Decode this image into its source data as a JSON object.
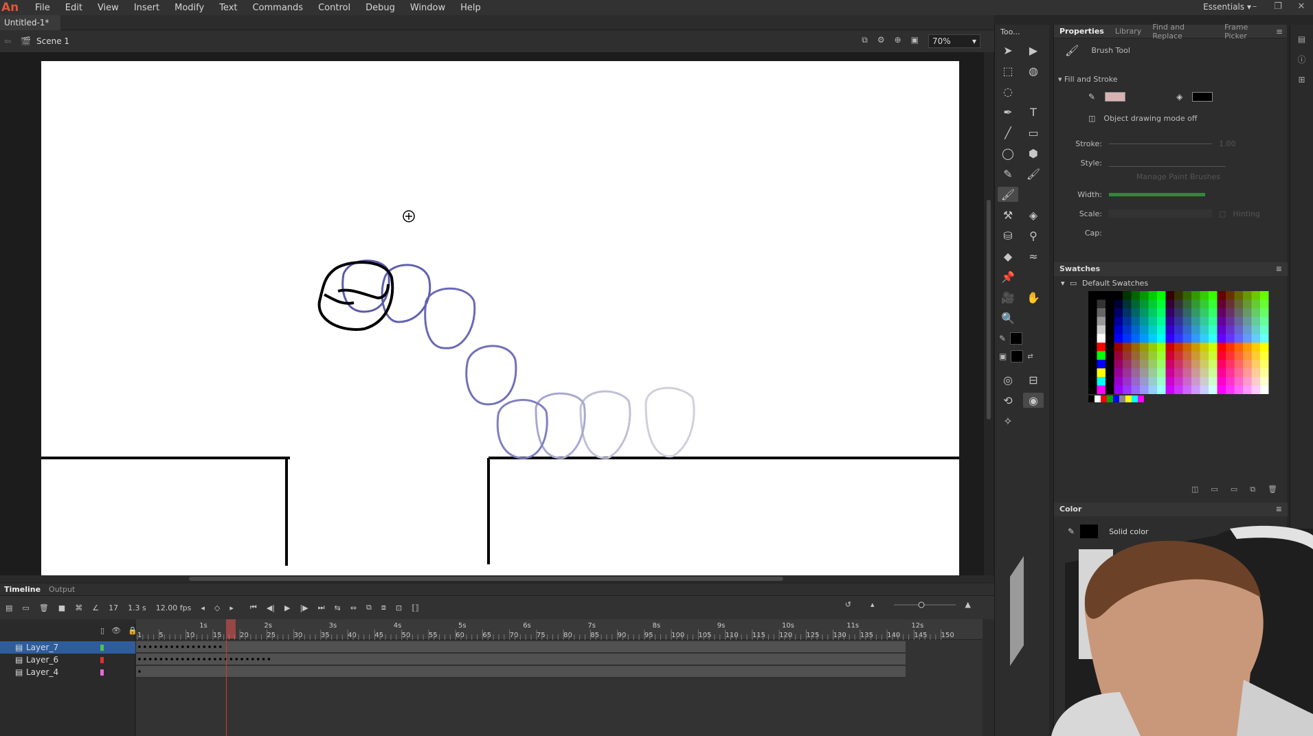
{
  "app": {
    "logo": "An",
    "workspace": "Essentials"
  },
  "menu": [
    "File",
    "Edit",
    "View",
    "Insert",
    "Modify",
    "Text",
    "Commands",
    "Control",
    "Debug",
    "Window",
    "Help"
  ],
  "document": {
    "tab_title": "Untitled-1*",
    "scene": "Scene 1",
    "zoom": "70%"
  },
  "timeline": {
    "tabs": [
      "Timeline",
      "Output"
    ],
    "current_frame": "17",
    "time": "1.3 s",
    "fps": "12.00 fps",
    "second_labels": [
      "1s",
      "2s",
      "3s",
      "4s",
      "5s",
      "6s",
      "7s",
      "8s",
      "9s",
      "10s",
      "11s",
      "12s"
    ],
    "frame_labels": [
      "1",
      "5",
      "10",
      "15",
      "20",
      "25",
      "30",
      "35",
      "40",
      "45",
      "50",
      "55",
      "60",
      "65",
      "70",
      "75",
      "80",
      "85",
      "90",
      "95",
      "100",
      "105",
      "110",
      "115",
      "120",
      "125",
      "130",
      "135",
      "140",
      "145",
      "150"
    ],
    "layers": [
      {
        "name": "Layer_7",
        "color": "#4fc24f",
        "selected": true
      },
      {
        "name": "Layer_6",
        "color": "#e03030",
        "selected": false
      },
      {
        "name": "Layer_4",
        "color": "#e36bd6",
        "selected": false
      }
    ]
  },
  "tools_panel": {
    "title": "Too...",
    "active_tool": "brush-icon"
  },
  "properties": {
    "tabs": [
      "Properties",
      "Library",
      "Find and Replace",
      "Frame Picker"
    ],
    "tool_name": "Brush Tool",
    "section": "Fill and Stroke",
    "object_drawing": "Object drawing mode off",
    "labels": {
      "stroke": "Stroke:",
      "style": "Style:",
      "width": "Width:",
      "scale": "Scale:",
      "cap": "Cap:",
      "hinting": "Hinting",
      "manage": "Manage Paint Brushes",
      "stroke_value": "1.00"
    },
    "fill_color": "#000000"
  },
  "swatches": {
    "title": "Swatches",
    "group": "Default Swatches"
  },
  "color_panel": {
    "title": "Color",
    "mode": "Solid color"
  }
}
